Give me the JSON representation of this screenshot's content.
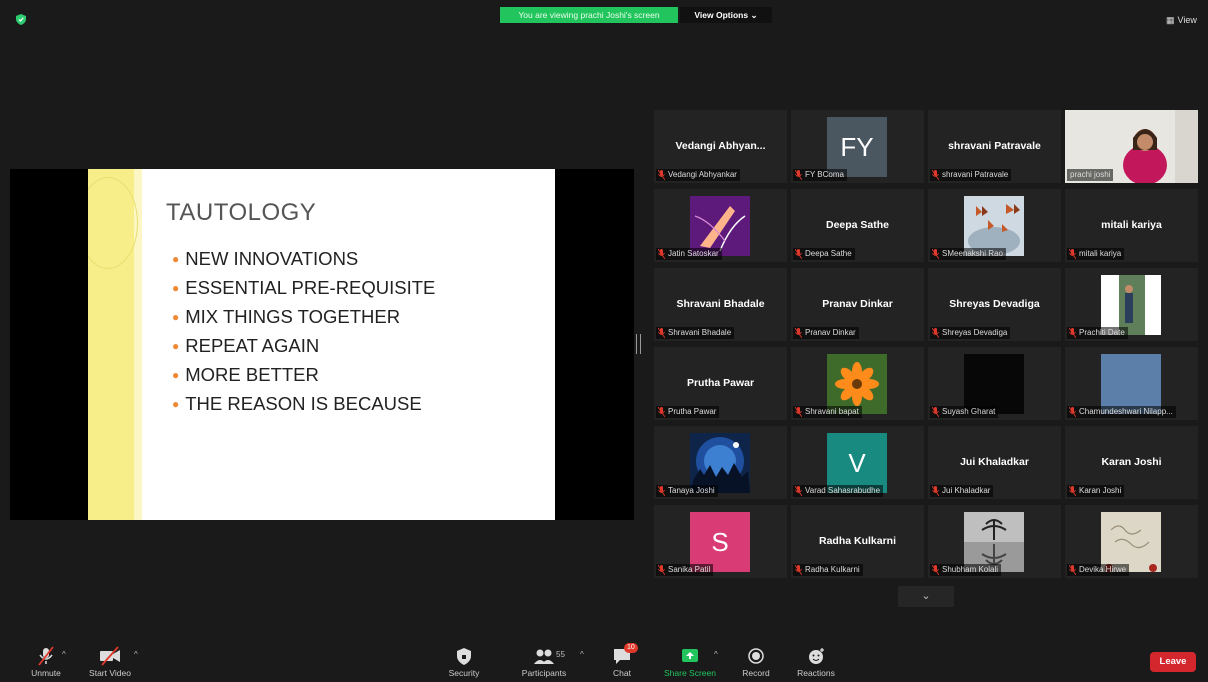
{
  "top_bar": {
    "sharing_banner": "You are viewing prachi Joshi's screen",
    "view_options": "View Options ⌄",
    "view_button": "View"
  },
  "slide": {
    "title": "TAUTOLOGY",
    "bullets": [
      "NEW INNOVATIONS",
      "ESSENTIAL PRE-REQUISITE",
      "MIX THINGS TOGETHER",
      "REPEAT AGAIN",
      "MORE BETTER",
      "THE REASON IS BECAUSE"
    ]
  },
  "gallery": {
    "tiles": [
      {
        "center": "Vedangi  Abhyan...",
        "label": "Vedangi Abhyankar"
      },
      {
        "avatar": "FY",
        "label": "FY BComa",
        "color": "#4a5660"
      },
      {
        "center": "shravani Patravale",
        "label": "shravani Patravale"
      },
      {
        "label": "prachi joshi"
      },
      {
        "label": "Jatin Satoskar"
      },
      {
        "center": "Deepa Sathe",
        "label": "Deepa Sathe"
      },
      {
        "label": "SMeenakshi Rao"
      },
      {
        "center": "mitali kariya",
        "label": "mitali kariya"
      },
      {
        "center": "Shravani Bhadale",
        "label": "Shravani Bhadale"
      },
      {
        "center": "Pranav Dinkar",
        "label": "Pranav Dinkar"
      },
      {
        "center": "Shreyas Devadiga",
        "label": "Shreyas Devadiga"
      },
      {
        "label": "Prachiti Date"
      },
      {
        "center": "Prutha Pawar",
        "label": "Prutha Pawar"
      },
      {
        "label": "Shravani bapat"
      },
      {
        "label": "Suyash Gharat"
      },
      {
        "label": "Chamundeshwari Nilapp..."
      },
      {
        "label": "Tanaya Joshi"
      },
      {
        "avatar": "V",
        "label": "Varad Sahasrabudhe",
        "color": "#198a80"
      },
      {
        "center": "Jui Khaladkar",
        "label": "Jui Khaladkar"
      },
      {
        "center": "Karan Joshi",
        "label": "Karan Joshi"
      },
      {
        "avatar": "S",
        "label": "Sanika Patil",
        "color": "#d93b74"
      },
      {
        "center": "Radha Kulkarni",
        "label": "Radha Kulkarni"
      },
      {
        "label": "Shubham Kolali"
      },
      {
        "label": "Devika Hirwe"
      }
    ]
  },
  "toolbar": {
    "unmute": "Unmute",
    "start_video": "Start Video",
    "security": "Security",
    "participants": "Participants",
    "participants_count": "55",
    "chat": "Chat",
    "chat_badge": "10",
    "share_screen": "Share Screen",
    "record": "Record",
    "reactions": "Reactions",
    "leave": "Leave"
  },
  "colors": {
    "banner_green": "#22c45e",
    "leave_red": "#d4272d",
    "active_speaker": "#d6f05a",
    "bullet_orange": "#f08a36"
  }
}
